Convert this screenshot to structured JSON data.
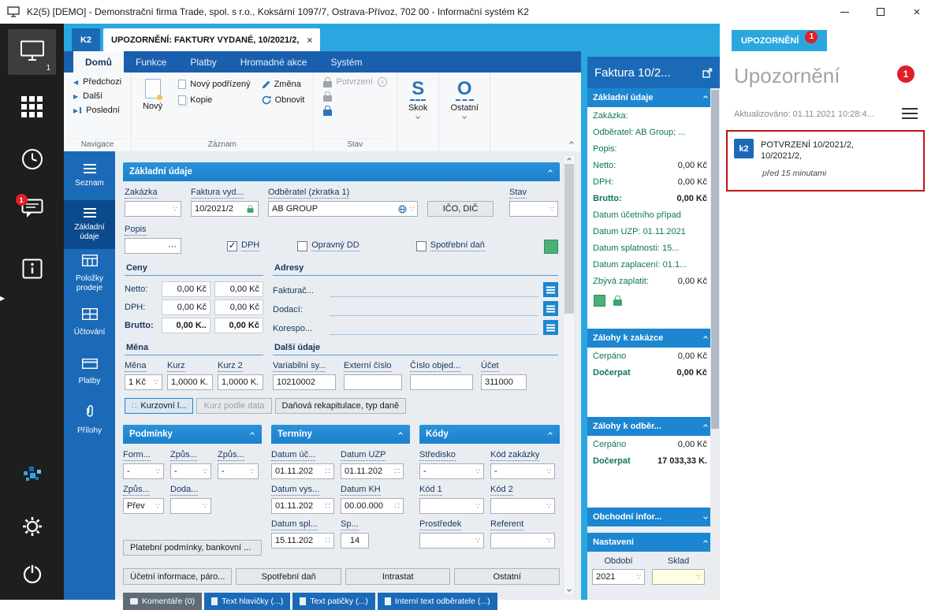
{
  "titlebar": {
    "title": "K2(5) [DEMO] - Demonstrační firma Trade, spol. s r.o., Koksární 1097/7, Ostrava-Přívoz, 702 00 - Informační systém K2"
  },
  "tabstrip": {
    "k2": "K2",
    "doc_tab": "UPOZORNĚNÍ: FAKTURY VYDANÉ, 10/2021/2,",
    "alerts_tab": "UPOZORNĚNÍ",
    "alerts_badge": "1"
  },
  "ribbon": {
    "tabs": [
      "Domů",
      "Funkce",
      "Platby",
      "Hromadné akce",
      "Systém"
    ],
    "active_tab": "Domů",
    "nav_prev": "Předchozi",
    "nav_next": "Další",
    "nav_last": "Poslední",
    "nav_group": "Navigace",
    "new": "Nový",
    "new_child": "Nový podřízený",
    "change": "Změna",
    "copy": "Kopie",
    "refresh": "Obnovit",
    "record_group": "Záznam",
    "confirm": "Potvrzení",
    "state_group": "Stav",
    "skok_glyph": "S",
    "skok": "Skok",
    "ostatni_glyph": "O",
    "ostatni": "Ostatní"
  },
  "nav": {
    "items": [
      {
        "label": "Seznam"
      },
      {
        "label": "Základní údaje",
        "active": true
      },
      {
        "label": "Položky prodeje"
      },
      {
        "label": "Účtování"
      },
      {
        "label": "Platby"
      },
      {
        "label": "Přílohy"
      }
    ]
  },
  "form": {
    "section_title": "Základní údaje",
    "zakazka_label": "Zakázka",
    "zakazka_value": "",
    "faktura_label": "Faktura vyd...",
    "faktura_value": "10/2021/2",
    "odberatel_label": "Odběratel (zkratka 1)",
    "odberatel_value": "AB GROUP",
    "ico_dic": "IČO, DIČ",
    "stav_label": "Stav",
    "stav_value": "",
    "popis_label": "Popis",
    "dph_label": "DPH",
    "dph_checked": true,
    "opravny_label": "Opravný DD",
    "opravny_checked": false,
    "spotrebni_label": "Spotřební daň",
    "spotrebni_checked": false,
    "ceny": {
      "title": "Ceny",
      "rows": [
        {
          "label": "Netto:",
          "v1": "0,00 Kč",
          "v2": "0,00 Kč"
        },
        {
          "label": "DPH:",
          "v1": "0,00 Kč",
          "v2": "0,00 Kč"
        },
        {
          "label": "Brutto:",
          "v1": "0,00 K..",
          "v2": "0,00 Kč",
          "bold": true
        }
      ]
    },
    "adresy": {
      "title": "Adresy",
      "rows": [
        {
          "label": "Fakturač..."
        },
        {
          "label": "Dodací:"
        },
        {
          "label": "Korespo..."
        }
      ]
    },
    "mena": {
      "title": "Měna",
      "mena_label": "Měna",
      "mena_value": "1 Kč",
      "kurz_label": "Kurz",
      "kurz_value": "1,0000 K.",
      "kurz2_label": "Kurz 2",
      "kurz2_value": "1,0000 K.."
    },
    "dalsi": {
      "title": "Další údaje",
      "vs_label": "Variabilní sy...",
      "vs_value": "10210002",
      "ext_label": "Externí číslo",
      "ext_value": "",
      "obj_label": "Číslo objed...",
      "obj_value": "",
      "ucet_label": "Účet",
      "ucet_value": "311000"
    },
    "buttons": {
      "kurzovni": "Kurzovní l...",
      "kurz_podle": "Kurz podle data",
      "danova": "Daňová rekapitulace, typ daně"
    },
    "podminky": {
      "title": "Podmínky",
      "f1_label": "Form...",
      "f1_value": "-",
      "f2_label": "Způs...",
      "f2_value": "-",
      "f3_label": "Způs...",
      "f3_value": "-",
      "f4_label": "Způs...",
      "f4_value": "Přev",
      "f5_label": "Doda...",
      "f5_value": "",
      "button": "Platební podmínky, bankovní ..."
    },
    "terminy": {
      "title": "Termíny",
      "f1_label": "Datum úč...",
      "f1_value": "01.11.202",
      "f2_label": "Datum UZP",
      "f2_value": "01.11.202",
      "f3_label": "Datum vys...",
      "f3_value": "01.11.202",
      "f4_label": "Datum KH",
      "f4_value": "00.00.000",
      "f5_label": "Datum spl...",
      "f5_value": "15.11.202",
      "f6_label": "Sp...",
      "f6_value": "14"
    },
    "kody": {
      "title": "Kódy",
      "f1_label": "Středisko",
      "f1_value": "-",
      "f2_label": "Kód zakázky",
      "f2_value": "-",
      "f3_label": "Kód 1",
      "f3_value": "",
      "f4_label": "Kód 2",
      "f4_value": "",
      "f5_label": "Prostředek",
      "f5_value": "",
      "f6_label": "Referent",
      "f6_value": ""
    },
    "footer_buttons": [
      "Účetní informace, páro...",
      "Spotřební daň",
      "Intrastat",
      "Ostatní"
    ],
    "footer_tabs": [
      "Komentáře (0)",
      "Text hlavičky (...)",
      "Text patičky (...)",
      "Interní text odběratele (...)"
    ]
  },
  "preview": {
    "title": "Faktura 10/2...",
    "basic": {
      "title": "Základní údaje",
      "rows": [
        {
          "label": "Zakázka:",
          "value": ""
        },
        {
          "label": "Odběratel: AB Group; ...",
          "value": ""
        },
        {
          "label": "Popis:",
          "value": ""
        },
        {
          "label": "Netto:",
          "value": "0,00 Kč"
        },
        {
          "label": "DPH:",
          "value": "0,00 Kč"
        },
        {
          "label": "Brutto:",
          "value": "0,00 Kč",
          "bold": true
        },
        {
          "label": "Datum účetního případ",
          "value": ""
        },
        {
          "label": "Datum UZP: 01.11.2021",
          "value": ""
        },
        {
          "label": "Datum splatnosti: 15...",
          "value": ""
        },
        {
          "label": "Datum zaplacení: 01.1...",
          "value": ""
        },
        {
          "label": "Zbývá zaplatit:",
          "value": "0,00 Kč"
        }
      ]
    },
    "zalohy_zakazka": {
      "title": "Zálohy k zakázce",
      "cerpano_label": "Čerpáno",
      "cerpano": "0,00 Kč",
      "docerpat_label": "Dočerpat",
      "docerpat": "0,00 Kč"
    },
    "zalohy_odberatel": {
      "title": "Zálohy k odběr...",
      "cerpano_label": "Čerpáno",
      "cerpano": "0,00 Kč",
      "docerpat_label": "Dočerpat",
      "docerpat": "17 033,33 K."
    },
    "obchodni_title": "Obchodní infor...",
    "nastaveni": {
      "title": "Nastavení",
      "obdobi_label": "Období",
      "obdobi_value": "2021",
      "sklad_label": "Sklad",
      "sklad_value": ""
    }
  },
  "alerts": {
    "title": "Upozornění",
    "badge": "1",
    "updated": "Aktualizováno: 01.11.2021 10:28:4...",
    "item": {
      "logo": "k2",
      "line1": "POTVRZENÍ 10/2021/2,",
      "line2": "10/2021/2,",
      "time": "před 15 minutami"
    }
  },
  "icons": {
    "combo_dropdown": "∵",
    "date_picker": "∷",
    "ellipsis": "⋯",
    "close": "×",
    "check": "✓",
    "prev_arrow": "◀",
    "next_arrow": "▶"
  },
  "colors": {
    "accent_cyan": "#2BA7E0",
    "ribbon_blue": "#1A5FAE",
    "panel_blue": "#1B6AB8",
    "section_blue": "#1C86D1",
    "alert_red": "#E01F26",
    "ok_green": "#4CAF78",
    "preview_label_teal": "#0E7460"
  }
}
